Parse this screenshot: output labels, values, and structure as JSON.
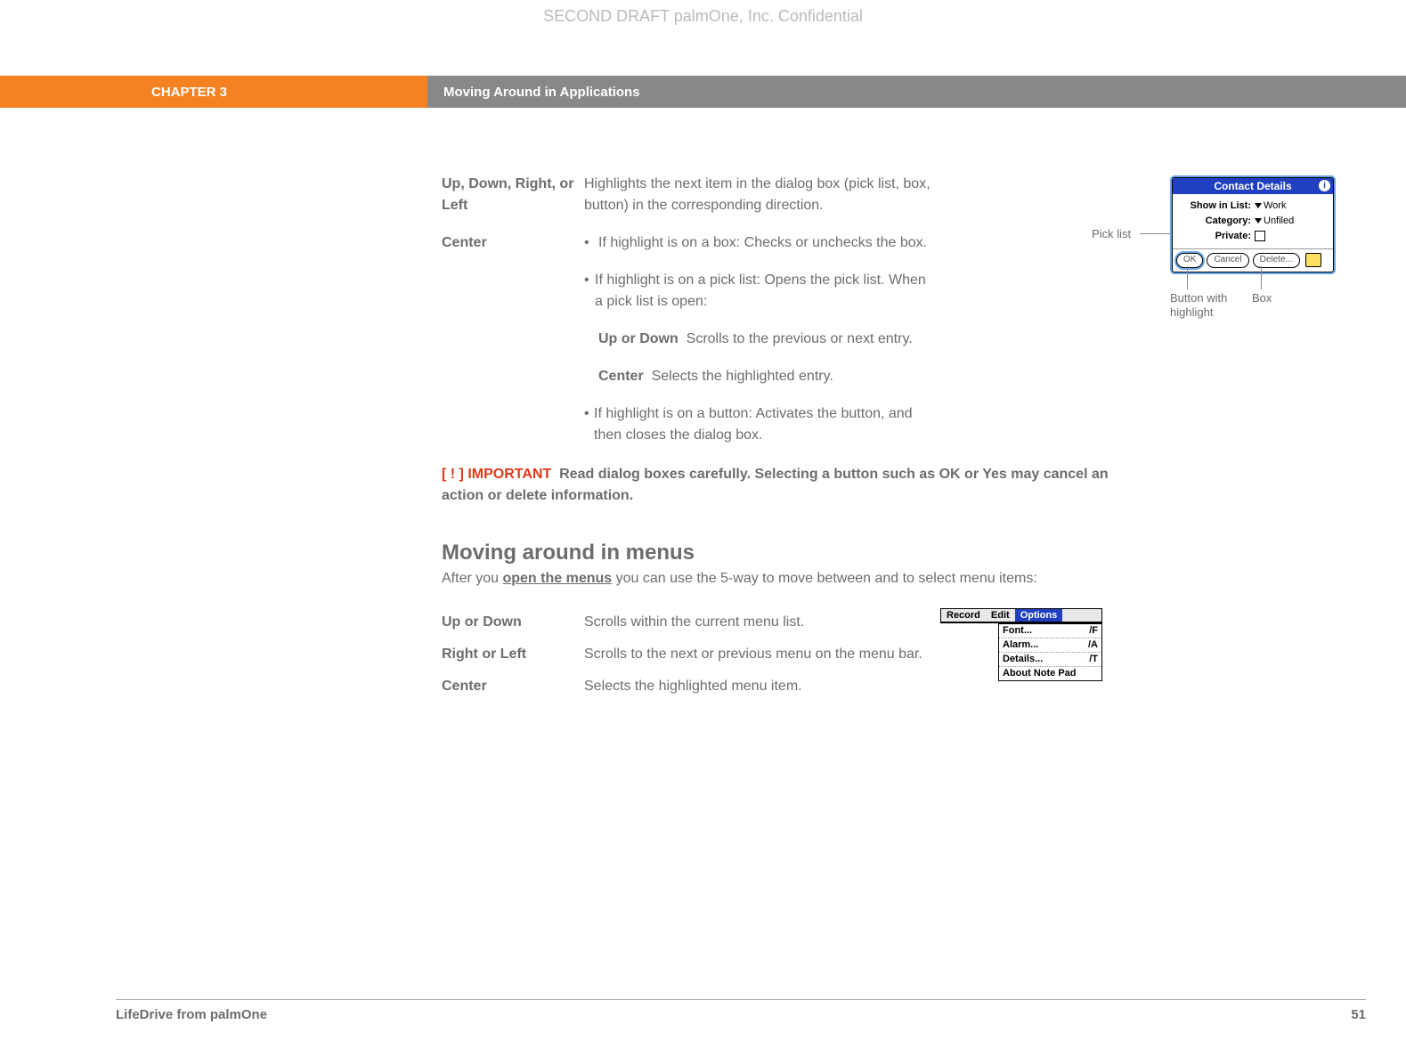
{
  "watermark": "SECOND DRAFT palmOne, Inc.  Confidential",
  "header": {
    "chapter": "CHAPTER 3",
    "title": "Moving Around in Applications"
  },
  "nav_table": {
    "row1": {
      "term": "Up, Down, Right, or Left",
      "desc": "Highlights the next item in the dialog box (pick list, box, button) in the corresponding direction."
    },
    "row2": {
      "term": "Center",
      "b1": "If highlight is on a box: Checks or unchecks the box.",
      "b2": "If highlight is on a pick list: Opens the pick list. When a pick list is open:",
      "sub1_term": "Up or Down",
      "sub1_text": "Scrolls to the previous or next entry.",
      "sub2_term": "Center",
      "sub2_text": "Selects the highlighted entry.",
      "b3": "If highlight is on a button: Activates the button, and then closes the dialog box."
    }
  },
  "important": {
    "tag": "[ ! ] IMPORTANT",
    "text": "Read dialog boxes carefully. Selecting a button such as OK or Yes may cancel an action or delete information."
  },
  "section2": {
    "heading": "Moving around in menus",
    "intro_pre": "After you ",
    "intro_link": "open the menus",
    "intro_post": " you can use the 5-way to move between and to select menu items:",
    "rows": {
      "r1": {
        "term": "Up or Down",
        "desc": "Scrolls within the current menu list."
      },
      "r2": {
        "term": "Right or Left",
        "desc": "Scrolls to the next or previous menu on the menu bar."
      },
      "r3": {
        "term": "Center",
        "desc": "Selects the highlighted menu item."
      }
    }
  },
  "dialog_fig": {
    "title": "Contact Details",
    "show_label": "Show in List:",
    "show_value": "Work",
    "cat_label": "Category:",
    "cat_value": "Unfiled",
    "priv_label": "Private:",
    "ok": "OK",
    "cancel": "Cancel",
    "delete": "Delete...",
    "annot_picklist": "Pick list",
    "annot_button": "Button with highlight",
    "annot_box": "Box"
  },
  "menu_fig": {
    "m1": "Record",
    "m2": "Edit",
    "m3": "Options",
    "items": {
      "i1": {
        "l": "Font...",
        "r": "/F"
      },
      "i2": {
        "l": "Alarm...",
        "r": "/A"
      },
      "i3": {
        "l": "Details...",
        "r": "/T"
      },
      "i4": {
        "l": "About Note Pad",
        "r": ""
      }
    }
  },
  "footer": {
    "product": "LifeDrive from palmOne",
    "page": "51"
  }
}
